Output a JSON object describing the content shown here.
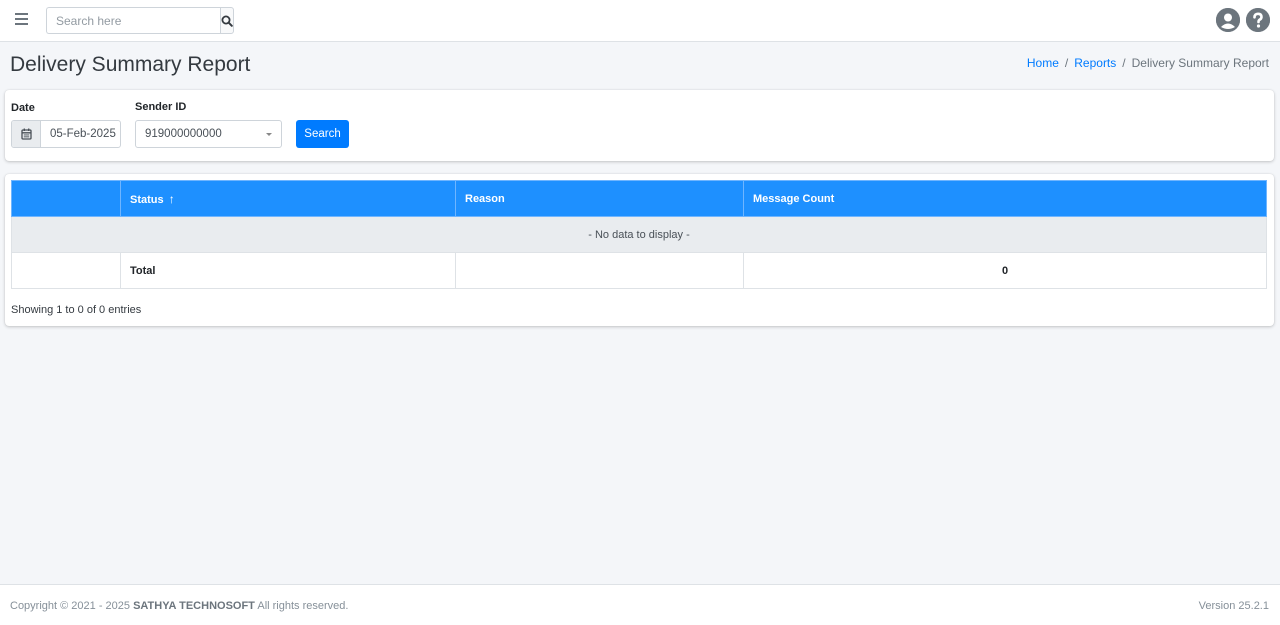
{
  "navbar": {
    "search_placeholder": "Search here",
    "icons": [
      "menu-icon",
      "search-icon",
      "user-circle-icon",
      "help-circle-icon"
    ]
  },
  "header": {
    "title": "Delivery Summary Report",
    "breadcrumb": [
      {
        "label": "Home",
        "link": true
      },
      {
        "label": "Reports",
        "link": true
      },
      {
        "label": "Delivery Summary Report",
        "link": false
      }
    ],
    "breadcrumb_separator": "/"
  },
  "filters": {
    "date_label": "Date",
    "date_value": "05-Feb-2025",
    "sender_label": "Sender ID",
    "sender_value": "919000000000",
    "search_label": "Search"
  },
  "table": {
    "columns": [
      "",
      "Status",
      "Reason",
      "Message Count"
    ],
    "sort_indicator": "↑",
    "empty_message": "- No data to display -",
    "total_label": "Total",
    "total_reason": "",
    "total_count": "0",
    "footer_text": "Showing 1 to 0 of 0 entries"
  },
  "footer": {
    "copyright_prefix": "Copyright © 2021 - 2025",
    "company": "SATHYA TECHNOSOFT",
    "copyright_suffix": "All rights reserved.",
    "version": "Version 25.2.1"
  },
  "colors": {
    "primary": "#007bff",
    "table_header": "#1e90ff",
    "empty_row": "#e9ecef"
  }
}
